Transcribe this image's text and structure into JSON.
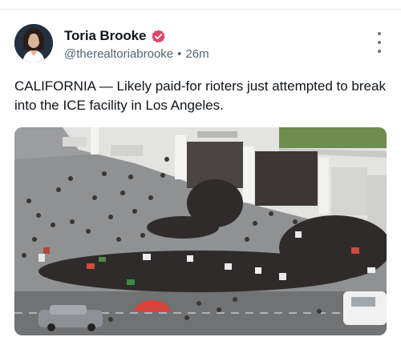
{
  "post": {
    "author": {
      "display_name": "Toria Brooke",
      "handle": "@therealtoriabrooke",
      "verified": true,
      "avatar_icon": "profile-photo"
    },
    "timestamp": "26m",
    "separator": "•",
    "text": "CALIFORNIA — Likely paid-for rioters just attempted to break into the ICE facility in Los Angeles.",
    "more_icon": "vertical-ellipsis-icon",
    "media": {
      "type": "photo",
      "subject": "aerial photo of crowd outside building"
    }
  },
  "colors": {
    "verified_badge": "#e0446a",
    "secondary_text": "#536471",
    "primary_text": "#0f1419"
  }
}
